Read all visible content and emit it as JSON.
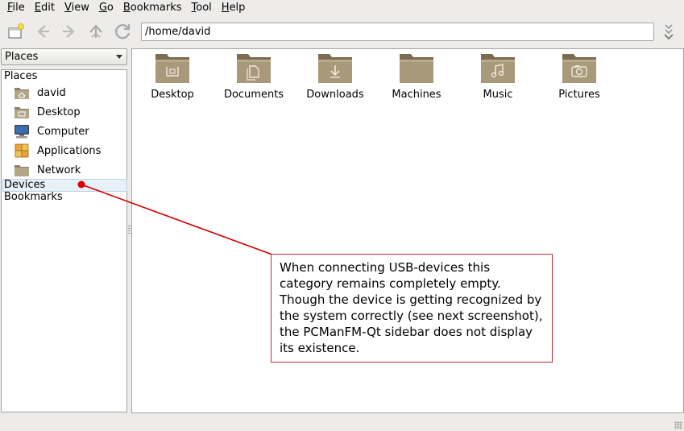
{
  "menu": [
    {
      "mnemonic": "F",
      "rest": "ile"
    },
    {
      "mnemonic": "E",
      "rest": "dit"
    },
    {
      "mnemonic": "V",
      "rest": "iew"
    },
    {
      "mnemonic": "G",
      "rest": "o"
    },
    {
      "mnemonic": "B",
      "rest": "ookmarks"
    },
    {
      "mnemonic": "T",
      "rest": "ool"
    },
    {
      "mnemonic": "H",
      "rest": "elp"
    }
  ],
  "toolbar": {
    "address_value": "/home/david"
  },
  "sidebar": {
    "combo_selected": "Places",
    "section_places": "Places",
    "items": [
      {
        "label": "david",
        "icon": "home-folder-icon"
      },
      {
        "label": "Desktop",
        "icon": "desktop-folder-icon"
      },
      {
        "label": "Computer",
        "icon": "computer-icon"
      },
      {
        "label": "Applications",
        "icon": "applications-icon"
      },
      {
        "label": "Network",
        "icon": "network-folder-icon"
      }
    ],
    "section_devices": "Devices",
    "section_bookmarks": "Bookmarks"
  },
  "files": [
    {
      "name": "Desktop",
      "icon": "desktop-folder-icon"
    },
    {
      "name": "Documents",
      "icon": "documents-folder-icon"
    },
    {
      "name": "Downloads",
      "icon": "downloads-folder-icon"
    },
    {
      "name": "Machines",
      "icon": "folder-icon"
    },
    {
      "name": "Music",
      "icon": "music-folder-icon"
    },
    {
      "name": "Pictures",
      "icon": "pictures-folder-icon"
    }
  ],
  "annotation": {
    "text": "When connecting USB-devices this category remains completely empty. Though the device is getting recognized by the system correctly (see next screenshot), the PCManFM-Qt sidebar does not display its existence.",
    "color": "#d40000"
  }
}
